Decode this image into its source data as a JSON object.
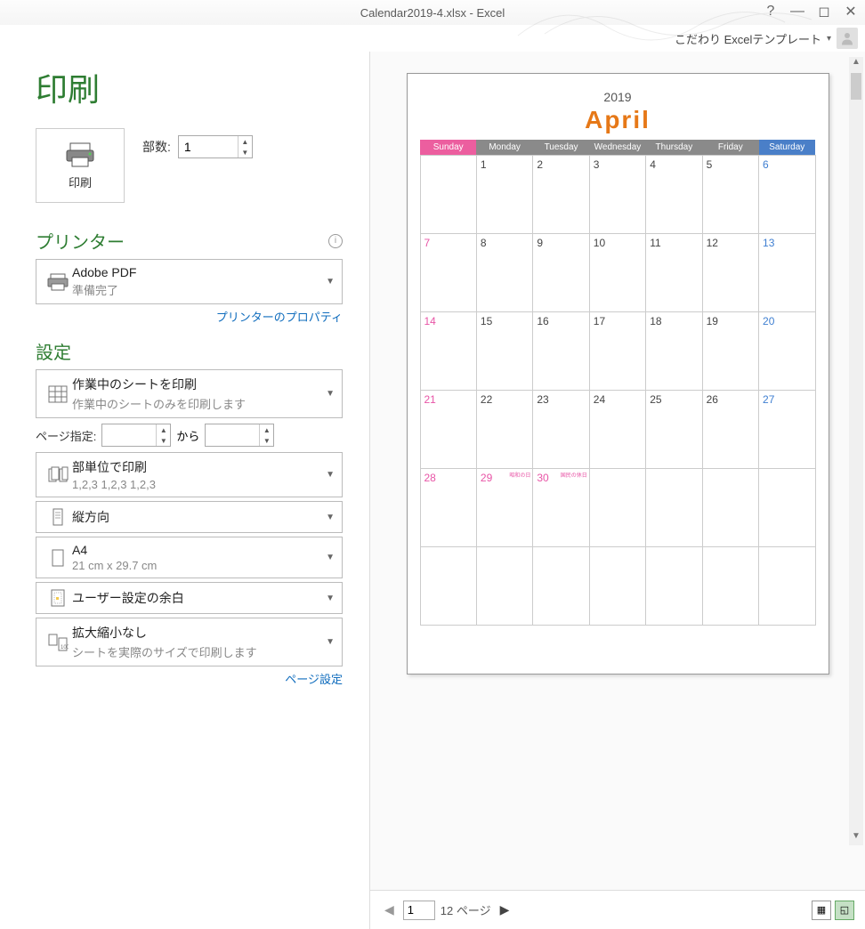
{
  "titlebar": {
    "text": "Calendar2019-4.xlsx - Excel"
  },
  "userbar": {
    "text": "こだわり Excelテンプレート"
  },
  "page_title": "印刷",
  "print_button": "印刷",
  "copies": {
    "label": "部数:",
    "value": "1"
  },
  "printer_section": "プリンター",
  "printer_dd": {
    "title": "Adobe PDF",
    "sub": "準備完了"
  },
  "printer_props_link": "プリンターのプロパティ",
  "settings_section": "設定",
  "dd_sheets": {
    "title": "作業中のシートを印刷",
    "sub": "作業中のシートのみを印刷します"
  },
  "page_range": {
    "label": "ページ指定:",
    "to": "から"
  },
  "dd_collate": {
    "title": "部単位で印刷",
    "sub": "1,2,3    1,2,3    1,2,3"
  },
  "dd_orientation": {
    "title": "縦方向"
  },
  "dd_paper": {
    "title": "A4",
    "sub": "21 cm x 29.7 cm"
  },
  "dd_margins": {
    "title": "ユーザー設定の余白"
  },
  "dd_scale": {
    "title": "拡大縮小なし",
    "sub": "シートを実際のサイズで印刷します"
  },
  "page_setup_link": "ページ設定",
  "nav": {
    "current": "1",
    "total": "12 ページ"
  },
  "calendar": {
    "year": "2019",
    "month": "April",
    "days": [
      "Sunday",
      "Monday",
      "Tuesday",
      "Wednesday",
      "Thursday",
      "Friday",
      "Saturday"
    ],
    "rows": [
      [
        {
          "n": ""
        },
        {
          "n": "1"
        },
        {
          "n": "2"
        },
        {
          "n": "3"
        },
        {
          "n": "4"
        },
        {
          "n": "5"
        },
        {
          "n": "6"
        }
      ],
      [
        {
          "n": "7"
        },
        {
          "n": "8"
        },
        {
          "n": "9"
        },
        {
          "n": "10"
        },
        {
          "n": "11"
        },
        {
          "n": "12"
        },
        {
          "n": "13"
        }
      ],
      [
        {
          "n": "14"
        },
        {
          "n": "15"
        },
        {
          "n": "16"
        },
        {
          "n": "17"
        },
        {
          "n": "18"
        },
        {
          "n": "19"
        },
        {
          "n": "20"
        }
      ],
      [
        {
          "n": "21"
        },
        {
          "n": "22"
        },
        {
          "n": "23"
        },
        {
          "n": "24"
        },
        {
          "n": "25"
        },
        {
          "n": "26"
        },
        {
          "n": "27"
        }
      ],
      [
        {
          "n": "28"
        },
        {
          "n": "29",
          "h": "昭和の日"
        },
        {
          "n": "30",
          "h": "国民の休日"
        },
        {
          "n": ""
        },
        {
          "n": ""
        },
        {
          "n": ""
        },
        {
          "n": ""
        }
      ],
      [
        {
          "n": ""
        },
        {
          "n": ""
        },
        {
          "n": ""
        },
        {
          "n": ""
        },
        {
          "n": ""
        },
        {
          "n": ""
        },
        {
          "n": ""
        }
      ]
    ]
  }
}
